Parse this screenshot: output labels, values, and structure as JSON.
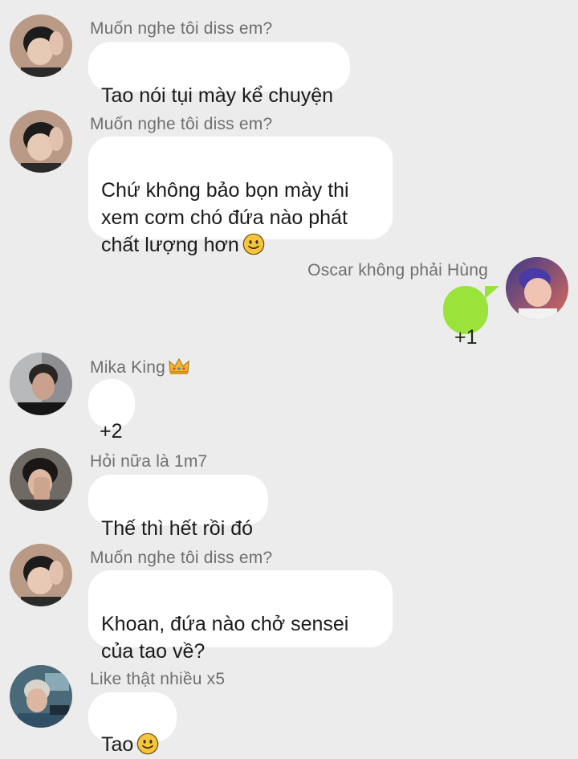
{
  "messages": [
    {
      "sender": "Muốn nghe tôi diss em?",
      "text": "Tao nói tụi mày kể chuyện",
      "emoji": ""
    },
    {
      "sender": "Muốn nghe tôi diss em?",
      "text": "Chứ không bảo bọn mày thi\nxem cơm chó đứa nào phát\nchất lượng hơn",
      "emoji": "smiley-emoji"
    },
    {
      "sender": "Oscar không phải Hùng",
      "text": "+1",
      "direction": "outgoing"
    },
    {
      "sender": "Mika King",
      "sender_badge": "crown-emoji",
      "text": "+2"
    },
    {
      "sender": "Hỏi nữa là 1m7",
      "text": "Thế thì hết rồi đó"
    },
    {
      "sender": "Muốn nghe tôi diss em?",
      "text": "Khoan, đứa nào chở sensei\ncủa tao về?"
    },
    {
      "sender": "Like thật nhiều x5",
      "text": "Tao",
      "emoji": "smiley-emoji"
    }
  ],
  "colors": {
    "background": "#ececec",
    "incoming_bubble": "#ffffff",
    "outgoing_bubble": "#9ae33a",
    "sender_text": "#6f6f6f"
  }
}
